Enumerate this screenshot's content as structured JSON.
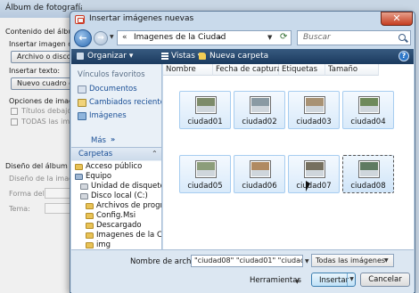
{
  "background_dialog": {
    "title": "Álbum de fotografía",
    "content_label": "Contenido del álbum",
    "insert_image_label": "Insertar imagen de:",
    "file_or_disk_button": "Archivo o disco...",
    "insert_text_label": "Insertar texto:",
    "new_textbox_button": "Nuevo cuadro de te",
    "image_options_label": "Opciones de imagen",
    "captions_option": "Títulos debajo de",
    "all_bw_option": "TODAS las imágen",
    "album_design_label": "Diseño del álbum",
    "image_layout_label": "Diseño de la imagen",
    "frame_shape_label": "Forma del marco:",
    "theme_label": "Tema:"
  },
  "dialog": {
    "title": "Insertar imágenes nuevas",
    "close_glyph": "✕"
  },
  "address": {
    "back_glyph": "←",
    "forward_glyph": "→",
    "prefix": "«",
    "path": "Imagenes de la Ciudad",
    "search_placeholder": "Buscar"
  },
  "toolbar": {
    "organize": "Organizar ▾",
    "views": "Vistas ▾",
    "new_folder": "Nueva carpeta",
    "help_glyph": "?"
  },
  "nav": {
    "favorites_header": "Vínculos favoritos",
    "links": [
      "Documentos",
      "Cambiados reciente...",
      "Imágenes"
    ],
    "more": "Más",
    "more_glyph": "»",
    "folders_label": "Carpetas",
    "folders_glyph": "⌃",
    "tree": [
      "Acceso público",
      "Equipo",
      "Unidad de disquete (",
      "Disco local (C:)",
      "Archivos de progran",
      "Config.Msi",
      "Descargado",
      "Imagenes de la Ciu",
      "img"
    ]
  },
  "files": {
    "columns": [
      "Nombre",
      "Fecha de captura",
      "Etiquetas",
      "Tamaño"
    ],
    "items": [
      {
        "name": "ciudad01",
        "thumb": "#7d8b6a"
      },
      {
        "name": "ciudad02",
        "thumb": "#8a9aa3"
      },
      {
        "name": "ciudad03",
        "thumb": "#a89274"
      },
      {
        "name": "ciudad04",
        "thumb": "#6f8a5b"
      },
      {
        "name": "ciudad05",
        "thumb": "#8c9d7a"
      },
      {
        "name": "ciudad06",
        "thumb": "#b08a62"
      },
      {
        "name": "ciudad07",
        "thumb": "#76705f"
      },
      {
        "name": "ciudad08",
        "thumb": "#5f7b62"
      }
    ]
  },
  "bottom": {
    "filename_label": "Nombre de archivo:",
    "filename_value": "\"ciudad08\" \"ciudad01\" \"ciudad02\" \"",
    "file_type": "Todas las imágenes",
    "tools": "Herramientas",
    "insert": "Insertar",
    "cancel": "Cancelar",
    "dropdown_glyph": "▼"
  }
}
